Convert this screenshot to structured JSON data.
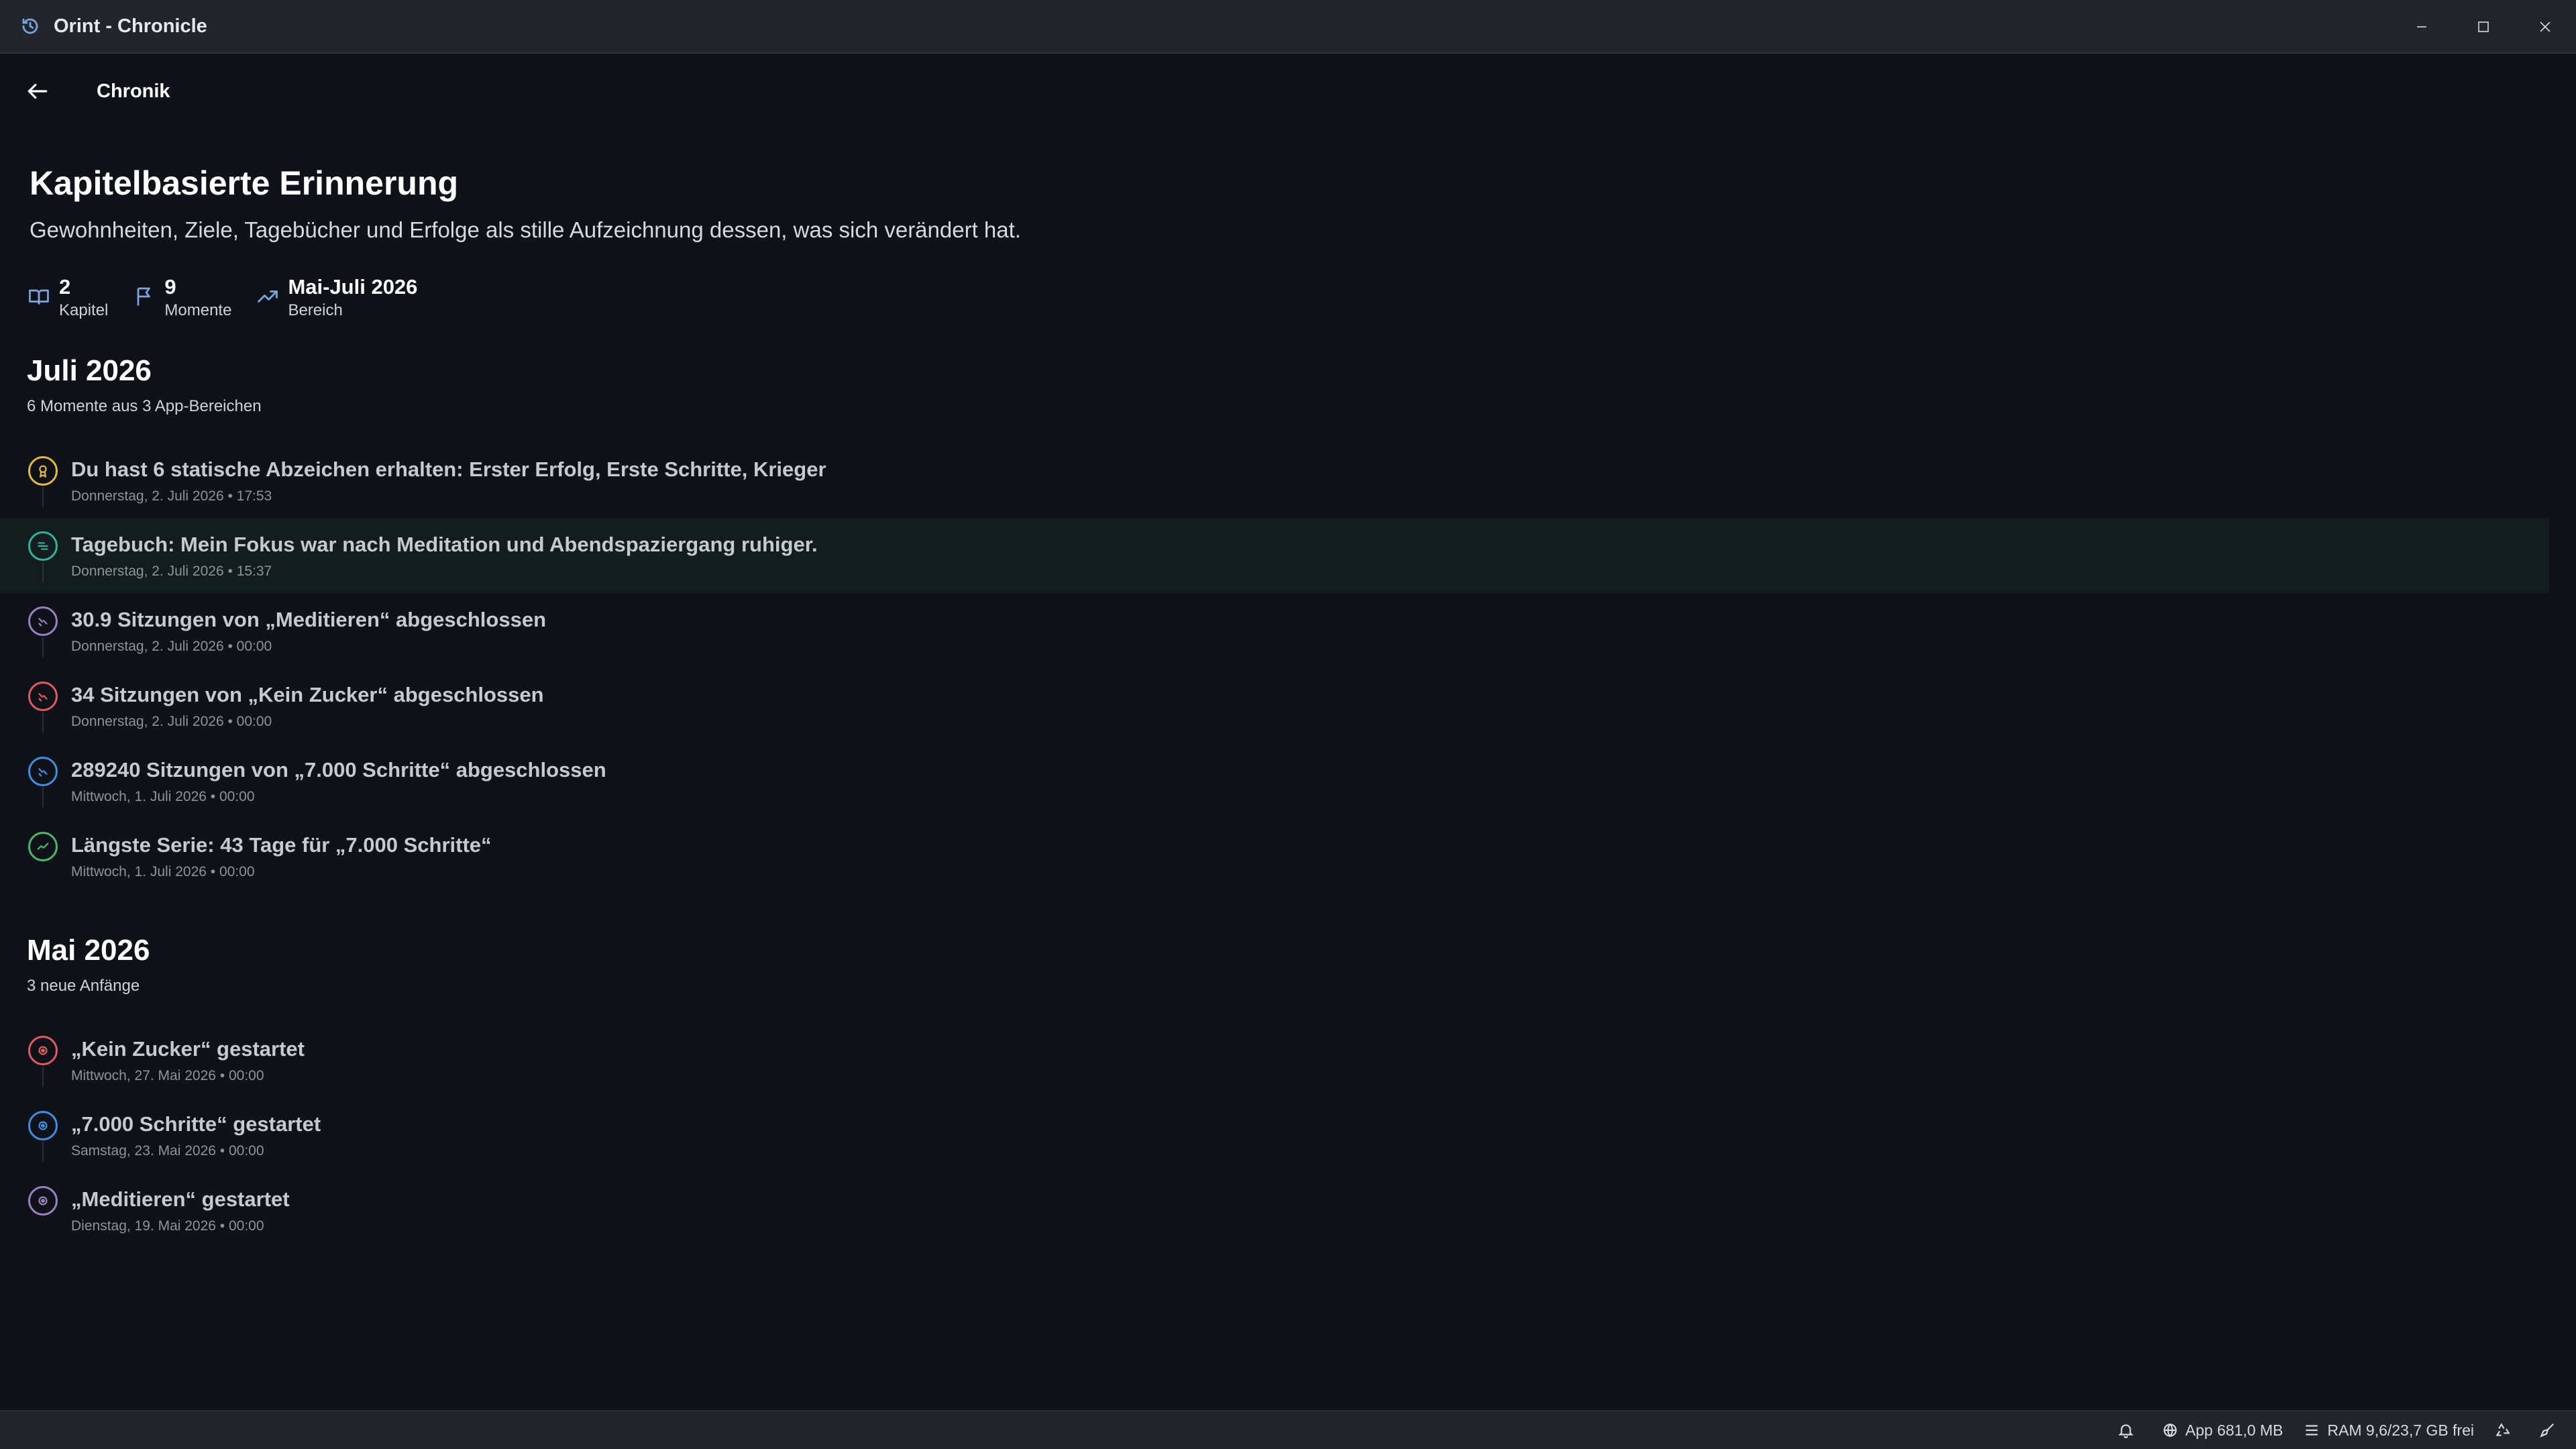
{
  "window": {
    "title": "Orint - Chronicle"
  },
  "header": {
    "title": "Chronik"
  },
  "hero": {
    "title": "Kapitelbasierte Erinnerung",
    "subtitle": "Gewohnheiten, Ziele, Tagebücher und Erfolge als stille Aufzeichnung dessen, was sich verändert hat."
  },
  "stats": {
    "chapters": {
      "value": "2",
      "label": "Kapitel"
    },
    "moments": {
      "value": "9",
      "label": "Momente"
    },
    "range": {
      "value": "Mai-Juli 2026",
      "label": "Bereich"
    }
  },
  "months": [
    {
      "title": "Juli 2026",
      "subtitle": "6 Momente aus 3 App-Bereichen",
      "items": [
        {
          "title": "Du hast 6 statische Abzeichen erhalten: Erster Erfolg, Erste Schritte, Krieger",
          "date": "Donnerstag, 2. Juli 2026 • 17:53",
          "color": "#e5b93a",
          "icon": "award-icon"
        },
        {
          "title": "Tagebuch: Mein Fokus war nach Meditation und Abendspaziergang ruhiger.",
          "date": "Donnerstag, 2. Juli 2026 • 15:37",
          "color": "#2fb39b",
          "icon": "journal-icon"
        },
        {
          "title": "30.9 Sitzungen von „Meditieren“ abgeschlossen",
          "date": "Donnerstag, 2. Juli 2026 • 00:00",
          "color": "#9b7fc0",
          "icon": "session-icon"
        },
        {
          "title": "34 Sitzungen von „Kein Zucker“ abgeschlossen",
          "date": "Donnerstag, 2. Juli 2026 • 00:00",
          "color": "#e05a5f",
          "icon": "session-icon"
        },
        {
          "title": "289240 Sitzungen von „7.000 Schritte“ abgeschlossen",
          "date": "Mittwoch, 1. Juli 2026 • 00:00",
          "color": "#3d8fe0",
          "icon": "session-icon"
        },
        {
          "title": "Längste Serie: 43 Tage für „7.000 Schritte“",
          "date": "Mittwoch, 1. Juli 2026 • 00:00",
          "color": "#49b86a",
          "icon": "trend-icon"
        }
      ]
    },
    {
      "title": "Mai 2026",
      "subtitle": "3 neue Anfänge",
      "items": [
        {
          "title": "„Kein Zucker“ gestartet",
          "date": "Mittwoch, 27. Mai 2026 • 00:00",
          "color": "#e05a5f",
          "icon": "start-icon"
        },
        {
          "title": "„7.000 Schritte“ gestartet",
          "date": "Samstag, 23. Mai 2026 • 00:00",
          "color": "#3d8fe0",
          "icon": "start-icon"
        },
        {
          "title": "„Meditieren“ gestartet",
          "date": "Dienstag, 19. Mai 2026 • 00:00",
          "color": "#9b7fc0",
          "icon": "start-icon"
        }
      ]
    }
  ],
  "statusbar": {
    "app_memory": "App 681,0 MB",
    "ram": "RAM 9,6/23,7 GB frei"
  },
  "colors": {
    "accent": "#7aa7e0",
    "background": "#0f1319",
    "titlebar": "#22262c"
  }
}
